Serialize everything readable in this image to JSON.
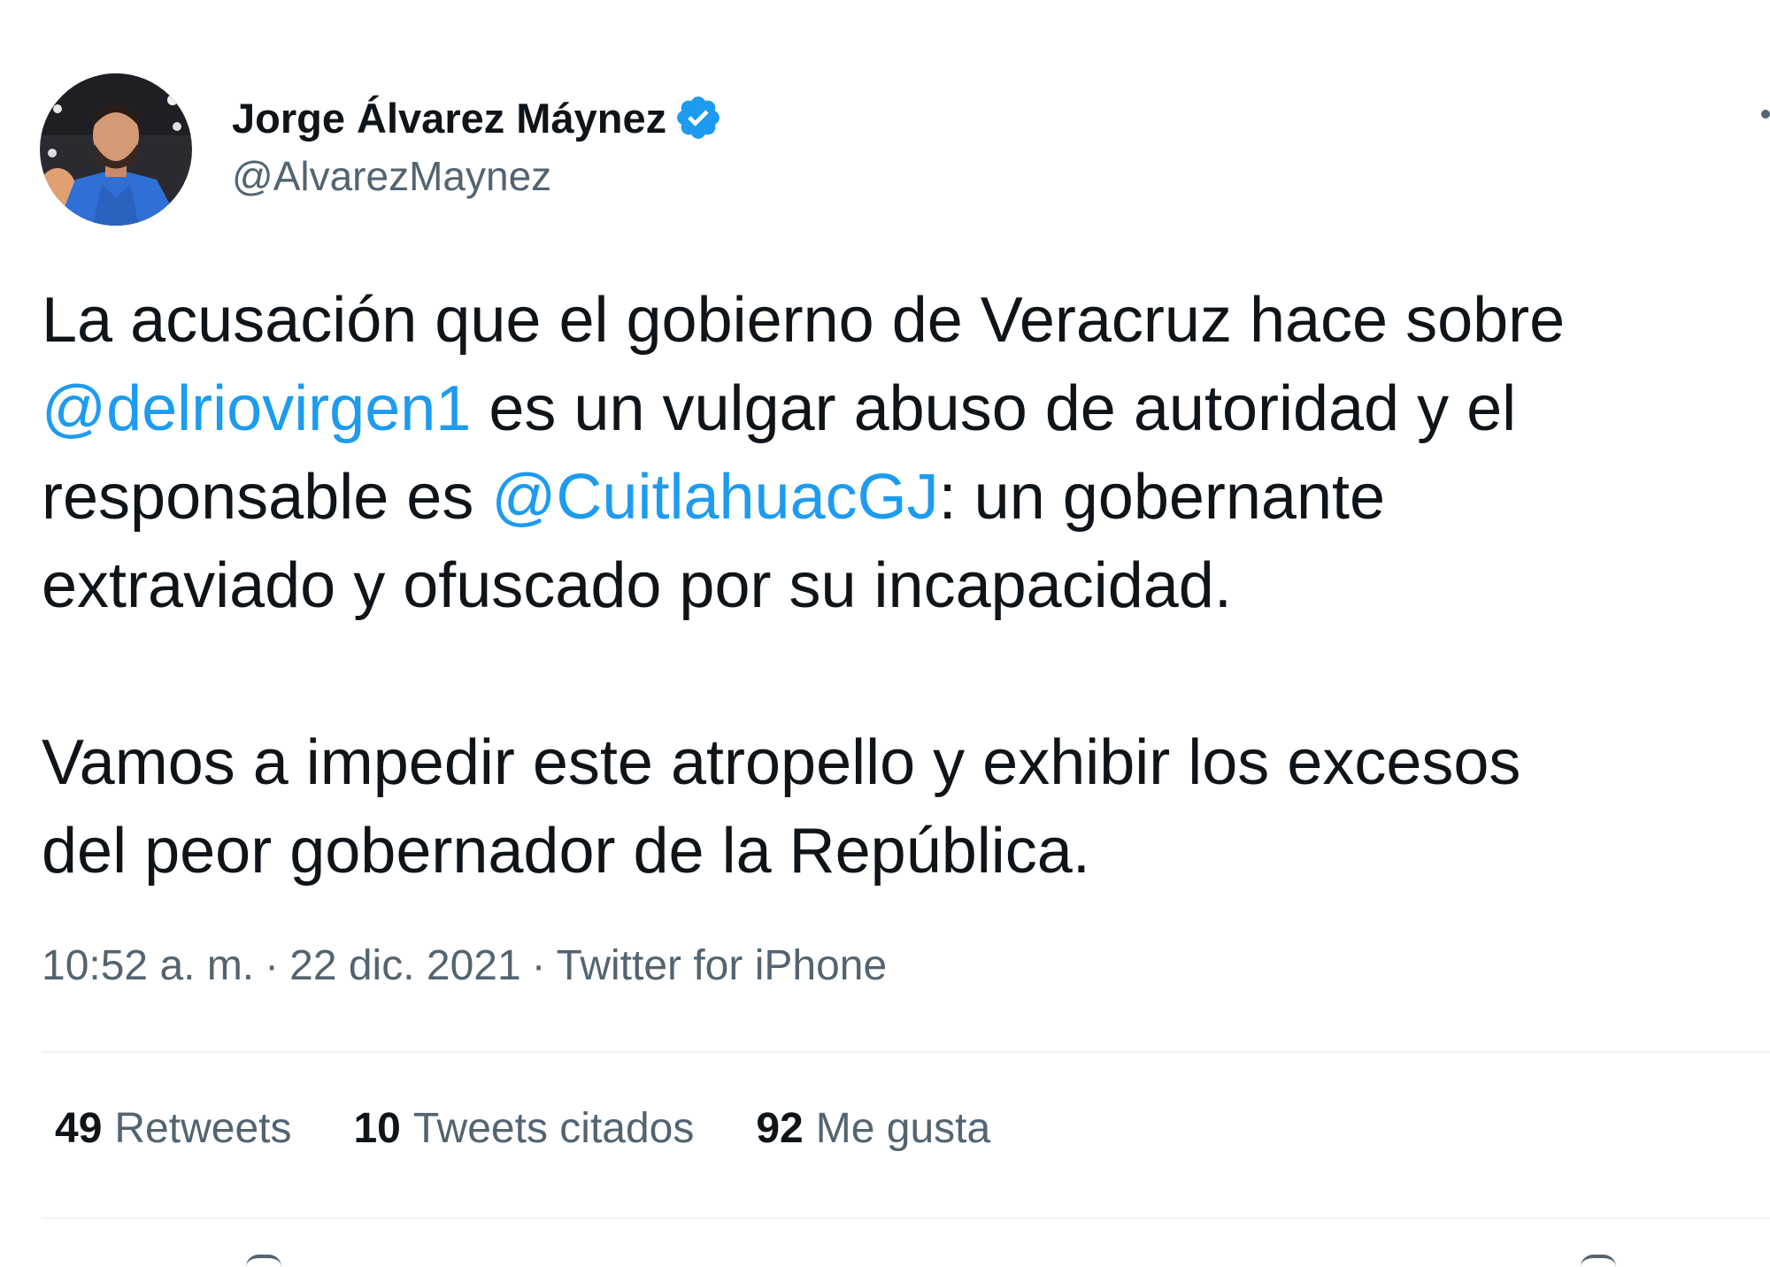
{
  "author": {
    "display_name": "Jorge Álvarez Máynez",
    "handle": "@AlvarezMaynez",
    "avatar_icon": "profile-photo",
    "verified_icon": "verified-badge-icon",
    "verified_color": "#1d9bf0"
  },
  "tweet": {
    "line1": "La acusación que el gobierno de Veracruz hace sobre",
    "mention1": "@delriovirgen1",
    "line2_rest": " es un vulgar abuso de autoridad y el",
    "line3_pre": "responsable es ",
    "mention2": "@CuitlahuacGJ",
    "line3_rest": ": un gobernante",
    "line4": "extraviado y ofuscado por su incapacidad.",
    "line5": "Vamos a impedir este atropello y exhibir los excesos",
    "line6": "del peor gobernador de la República."
  },
  "meta": {
    "time": "10:52 a. m.",
    "sep1": "·",
    "date": "22 dic. 2021",
    "sep2": "·",
    "source": "Twitter for iPhone"
  },
  "stats": {
    "retweets": {
      "count": "49",
      "label": "Retweets"
    },
    "quotes": {
      "count": "10",
      "label": "Tweets citados"
    },
    "likes": {
      "count": "92",
      "label": "Me gusta"
    }
  },
  "colors": {
    "mention": "#1d9bf0",
    "secondary_text": "#536471",
    "primary_text": "#0f1419",
    "divider": "#eff3f4"
  }
}
